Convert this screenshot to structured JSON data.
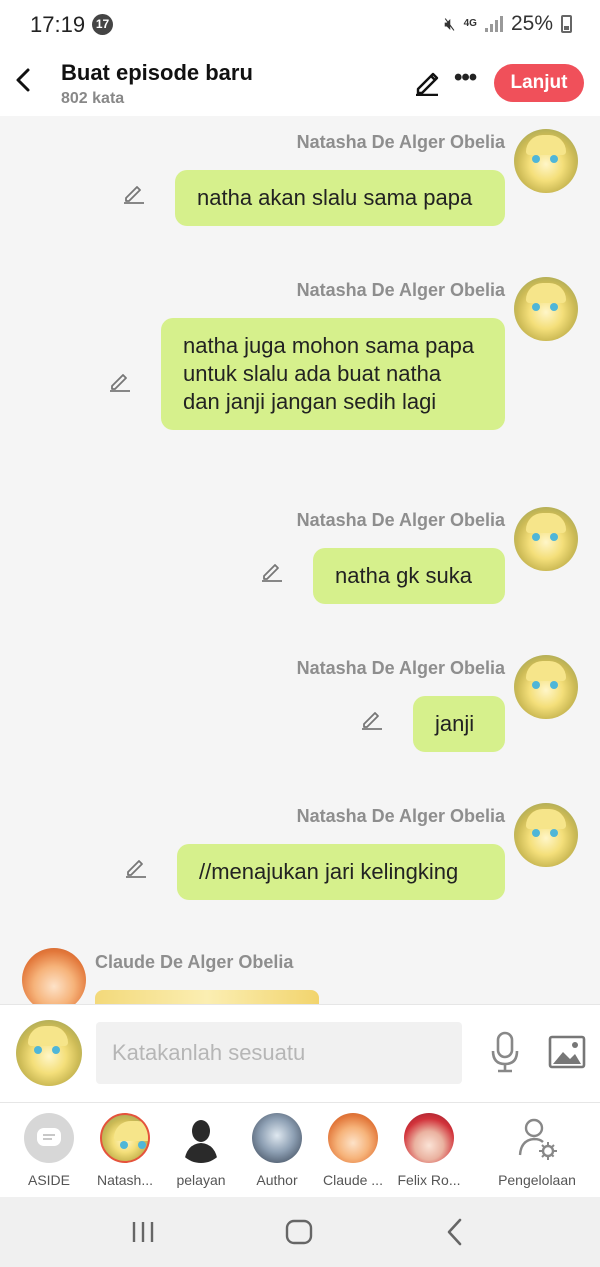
{
  "status_bar": {
    "time": "17:19",
    "notification_count": "17",
    "network": "4G",
    "battery": "25%"
  },
  "header": {
    "title": "Buat episode baru",
    "word_count": "802 kata",
    "next_label": "Lanjut",
    "more_label": "•••"
  },
  "messages": [
    {
      "sender": "Natasha De Alger Obelia",
      "text": "natha akan slalu sama papa"
    },
    {
      "sender": "Natasha De Alger Obelia",
      "text": "natha juga mohon sama papa untuk slalu ada buat natha dan janji jangan sedih lagi"
    },
    {
      "sender": "Natasha De Alger Obelia",
      "text": "natha gk suka"
    },
    {
      "sender": "Natasha De Alger Obelia",
      "text": "janji"
    },
    {
      "sender": "Natasha De Alger Obelia",
      "text": "//menajukan jari kelingking"
    }
  ],
  "last_message": {
    "sender": "Claude De Alger Obelia"
  },
  "input": {
    "placeholder": "Katakanlah sesuatu"
  },
  "characters": [
    {
      "label": "ASIDE"
    },
    {
      "label": "Natash..."
    },
    {
      "label": "pelayan"
    },
    {
      "label": "Author"
    },
    {
      "label": "Claude ..."
    },
    {
      "label": "Felix Ro..."
    },
    {
      "label": "Pengelolaan"
    }
  ],
  "colors": {
    "accent": "#f0505a",
    "bubble": "#d6f08c",
    "sender_text": "#8e8e8e"
  }
}
